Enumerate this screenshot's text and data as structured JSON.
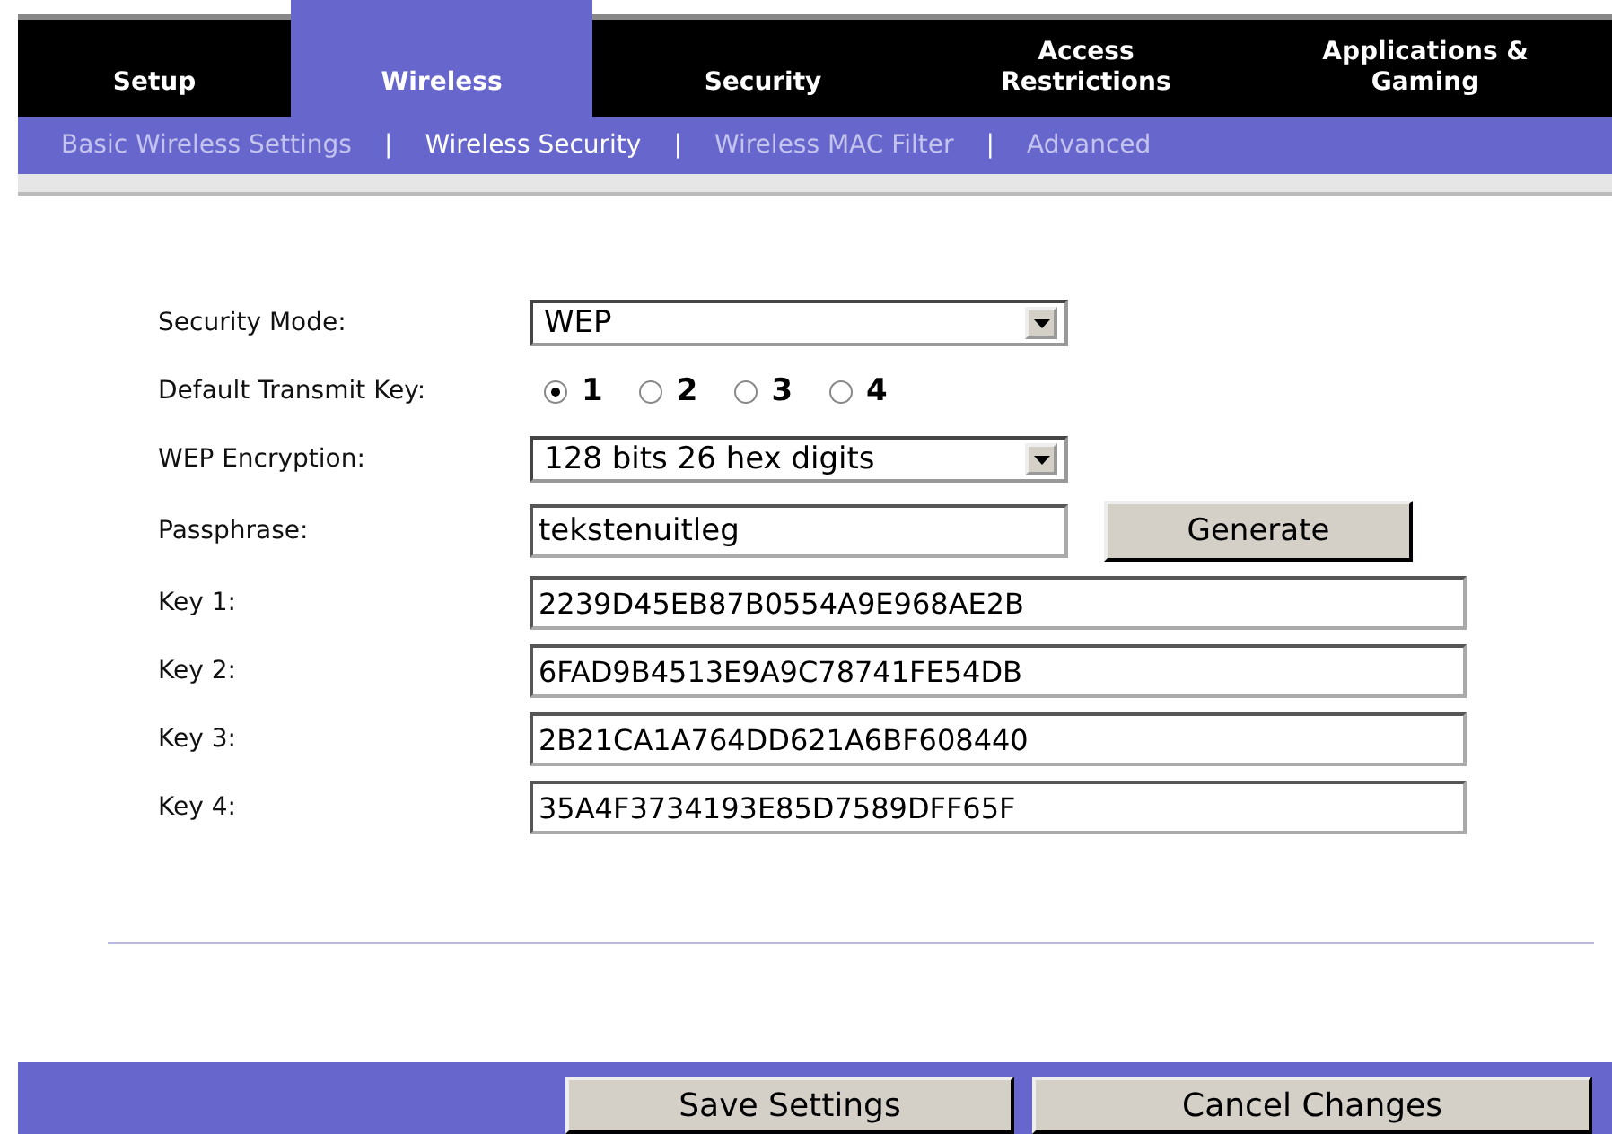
{
  "tabs": [
    {
      "label": "Setup",
      "selected": false
    },
    {
      "label": "Wireless",
      "selected": true
    },
    {
      "label": "Security",
      "selected": false
    },
    {
      "label": "Access Restrictions",
      "selected": false
    },
    {
      "label": "Applications & Gaming",
      "selected": false
    }
  ],
  "subnav": [
    {
      "kind": "link",
      "label": "Basic Wireless Settings",
      "selected": false
    },
    {
      "kind": "separator",
      "label": "|"
    },
    {
      "kind": "link",
      "label": "Wireless Security",
      "selected": true
    },
    {
      "kind": "separator",
      "label": "|"
    },
    {
      "kind": "link",
      "label": "Wireless MAC Filter",
      "selected": false
    },
    {
      "kind": "separator",
      "label": "|"
    },
    {
      "kind": "link",
      "label": "Advanced",
      "selected": false
    }
  ],
  "form": [
    {
      "kind": "select",
      "label": "Security Mode:",
      "value": "WEP"
    },
    {
      "kind": "radio",
      "label": "Default Transmit Key:",
      "options": [
        {
          "label": "1",
          "selected": true
        },
        {
          "label": "2",
          "selected": false
        },
        {
          "label": "3",
          "selected": false
        },
        {
          "label": "4",
          "selected": false
        }
      ]
    },
    {
      "kind": "select",
      "label": "WEP Encryption:",
      "value": "128 bits 26 hex digits"
    },
    {
      "kind": "passphrase",
      "label": "Passphrase:",
      "value": "tekstenuitleg",
      "button": "Generate"
    },
    {
      "kind": "text",
      "label": "Key 1:",
      "value": "2239D45EB87B0554A9E968AE2B"
    },
    {
      "kind": "text",
      "label": "Key 2:",
      "value": "6FAD9B4513E9A9C78741FE54DB"
    },
    {
      "kind": "text",
      "label": "Key 3:",
      "value": "2B21CA1A764DD621A6BF608440"
    },
    {
      "kind": "text",
      "label": "Key 4:",
      "value": "35A4F3734193E85D7589DFF65F"
    }
  ],
  "buttons": [
    "Save Settings",
    "Cancel Changes"
  ]
}
